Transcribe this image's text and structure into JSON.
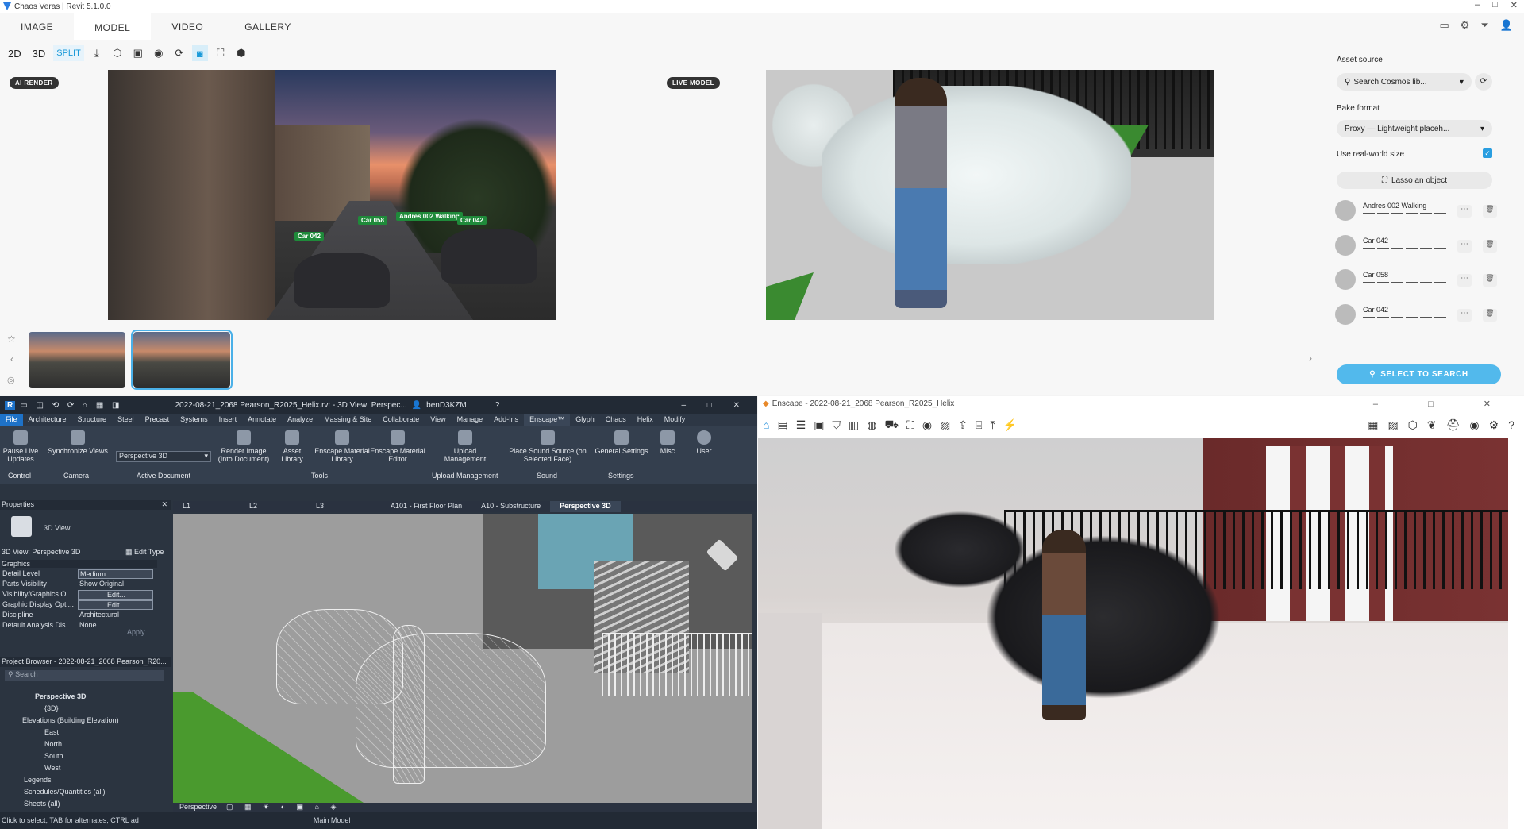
{
  "veras": {
    "title": "Chaos Veras | Revit 5.1.0.0",
    "tabs": [
      "IMAGE",
      "MODEL",
      "VIDEO",
      "GALLERY"
    ],
    "active_tab": "MODEL",
    "toolbar": {
      "b2d": "2D",
      "b3d": "3D",
      "split": "SPLIT"
    },
    "ai_render_label": "AI RENDER",
    "live_model_label": "LIVE MODEL",
    "render_tags": [
      "Car 058",
      "Andres 002 Walking",
      "Car 042",
      "Car 042"
    ],
    "sidebar": {
      "asset_source_label": "Asset source",
      "asset_source_value": "Search Cosmos lib...",
      "bake_format_label": "Bake format",
      "bake_format_value": "Proxy — Lightweight placeh...",
      "real_world_label": "Use real-world size",
      "real_world_checked": true,
      "lasso_label": "Lasso an object",
      "items": [
        {
          "name": "Andres 002 Walking"
        },
        {
          "name": "Car 042"
        },
        {
          "name": "Car 058"
        },
        {
          "name": "Car 042"
        }
      ],
      "select_search": "SELECT TO SEARCH"
    }
  },
  "revit": {
    "title": "2022-08-21_2068 Pearson_R2025_Helix.rvt - 3D View: Perspec...",
    "user": "benD3KZM",
    "menu": [
      "File",
      "Architecture",
      "Structure",
      "Steel",
      "Precast",
      "Systems",
      "Insert",
      "Annotate",
      "Analyze",
      "Massing & Site",
      "Collaborate",
      "View",
      "Manage",
      "Add-Ins",
      "Enscape™",
      "Glyph",
      "Chaos",
      "Helix",
      "Modify"
    ],
    "ribbon": {
      "pause": "Pause Live Updates",
      "sync": "Synchronize Views",
      "view_dropdown": "Perspective 3D",
      "render": "Render Image (Into Document)",
      "asset": "Asset Library",
      "matlib": "Enscape Material Library",
      "mated": "Enscape Material Editor",
      "upload": "Upload Management",
      "sound": "Place Sound Source (on Selected Face)",
      "general": "General Settings",
      "misc": "Misc",
      "user": "User",
      "groups": {
        "control": "Control",
        "camera": "Camera",
        "active": "Active Document",
        "tools": "Tools",
        "upload": "Upload Management",
        "sound": "Sound",
        "settings": "Settings"
      }
    },
    "view_tabs": [
      "L1",
      "L2",
      "L3",
      "A101 - First Floor Plan",
      "A10 - Substructure",
      "Perspective 3D"
    ],
    "properties": {
      "title": "Properties",
      "type": "3D View",
      "selector": "3D View: Perspective 3D",
      "edit_type": "Edit Type",
      "section": "Graphics",
      "rows": [
        {
          "k": "Detail Level",
          "v": "Medium"
        },
        {
          "k": "Parts Visibility",
          "v": "Show Original"
        },
        {
          "k": "Visibility/Graphics O...",
          "v": "Edit..."
        },
        {
          "k": "Graphic Display Opti...",
          "v": "Edit..."
        },
        {
          "k": "Discipline",
          "v": "Architectural"
        },
        {
          "k": "Default Analysis Dis...",
          "v": "None"
        }
      ],
      "apply": "Apply"
    },
    "browser": {
      "title": "Project Browser - 2022-08-21_2068 Pearson_R20...",
      "search": "Search",
      "items": [
        "Perspective 3D",
        "{3D}",
        "Elevations (Building Elevation)",
        "East",
        "North",
        "South",
        "West",
        "Legends",
        "Schedules/Quantities (all)",
        "Sheets (all)"
      ]
    },
    "view_bar": "Perspective",
    "status": "Click to select, TAB for alternates, CTRL ad",
    "model": "Main Model"
  },
  "enscape": {
    "title": "Enscape - 2022-08-21_2068 Pearson_R2025_Helix"
  }
}
